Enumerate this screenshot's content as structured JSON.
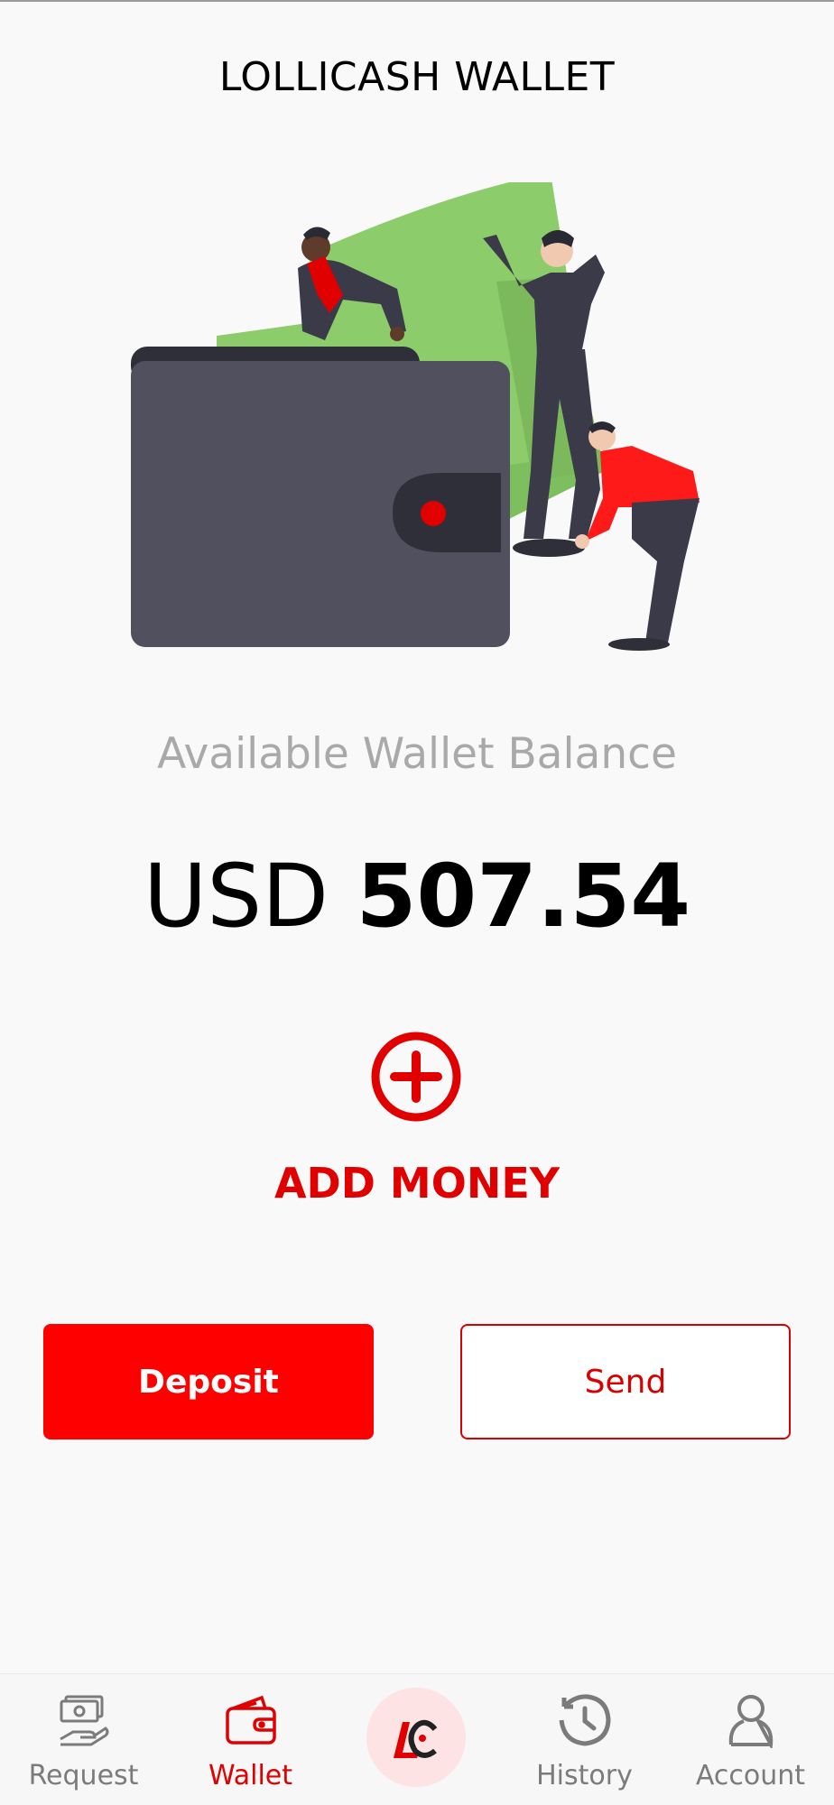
{
  "header": {
    "title": "LOLLICASH WALLET"
  },
  "balance": {
    "label": "Available Wallet Balance",
    "currency": "USD",
    "amount": "507.54"
  },
  "add_money": {
    "label": "ADD MONEY",
    "icon": "plus-circle-icon"
  },
  "actions": {
    "deposit_label": "Deposit",
    "send_label": "Send"
  },
  "nav": {
    "items": [
      {
        "label": "Request",
        "icon": "request-money-icon",
        "active": false
      },
      {
        "label": "Wallet",
        "icon": "wallet-icon",
        "active": true
      },
      {
        "label": "",
        "icon": "lollicash-logo-icon",
        "active": false
      },
      {
        "label": "History",
        "icon": "history-icon",
        "active": false
      },
      {
        "label": "Account",
        "icon": "account-icon",
        "active": false
      }
    ]
  },
  "colors": {
    "accent": "#e00000",
    "button": "#ff0000",
    "background": "#f9f9f9"
  }
}
